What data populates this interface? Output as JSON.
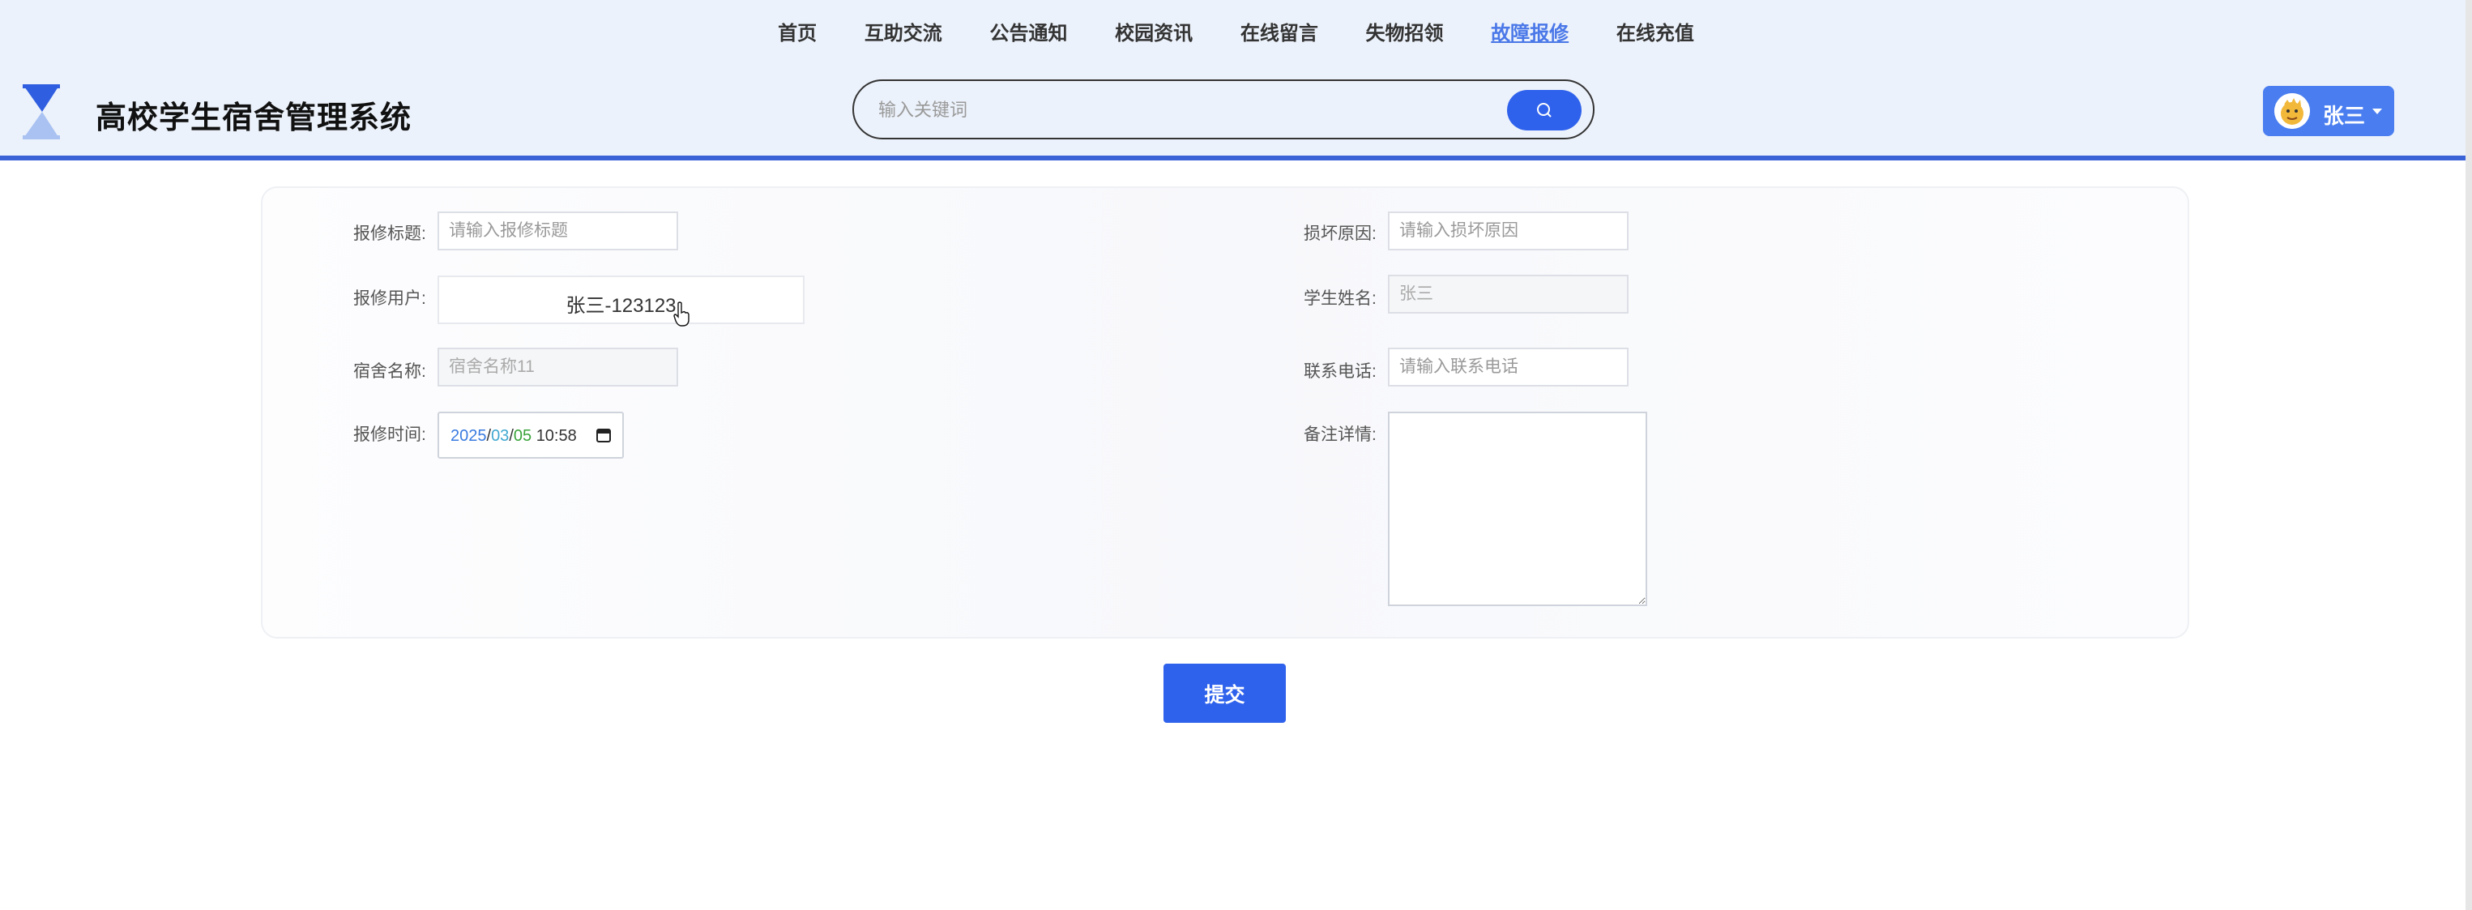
{
  "nav": {
    "items": [
      {
        "label": "首页"
      },
      {
        "label": "互助交流"
      },
      {
        "label": "公告通知"
      },
      {
        "label": "校园资讯"
      },
      {
        "label": "在线留言"
      },
      {
        "label": "失物招领"
      },
      {
        "label": "故障报修",
        "active": true
      },
      {
        "label": "在线充值"
      }
    ],
    "active_color": "#4a78e8"
  },
  "header": {
    "site_title": "高校学生宿舍管理系统",
    "logo_icon": "hourglass-icon"
  },
  "search": {
    "placeholder": "输入关键词",
    "value": "",
    "button_icon": "search-icon"
  },
  "user": {
    "name": "张三",
    "avatar_icon": "avatar-icon",
    "menu_icon": "caret-down-icon"
  },
  "form": {
    "repair_title": {
      "label": "报修标题:",
      "placeholder": "请输入报修标题",
      "value": ""
    },
    "damage_reason": {
      "label": "损坏原因:",
      "placeholder": "请输入损坏原因",
      "value": ""
    },
    "repair_user": {
      "label": "报修用户:",
      "value": "张三-123123"
    },
    "student_name": {
      "label": "学生姓名:",
      "placeholder": "张三",
      "value": ""
    },
    "dorm_name": {
      "label": "宿舍名称:",
      "placeholder": "宿舍名称11",
      "value": ""
    },
    "phone": {
      "label": "联系电话:",
      "placeholder": "请输入联系电话",
      "value": ""
    },
    "repair_time": {
      "label": "报修时间:",
      "year": "2025",
      "month": "03",
      "day": "05",
      "sep": "/",
      "time": "10:58",
      "icon": "calendar-icon"
    },
    "remarks": {
      "label": "备注详情:",
      "value": ""
    }
  },
  "submit": {
    "label": "提交"
  },
  "colors": {
    "primary": "#2f62ec",
    "header_bg": "#ecf2fb",
    "header_border": "#3a63d8"
  }
}
